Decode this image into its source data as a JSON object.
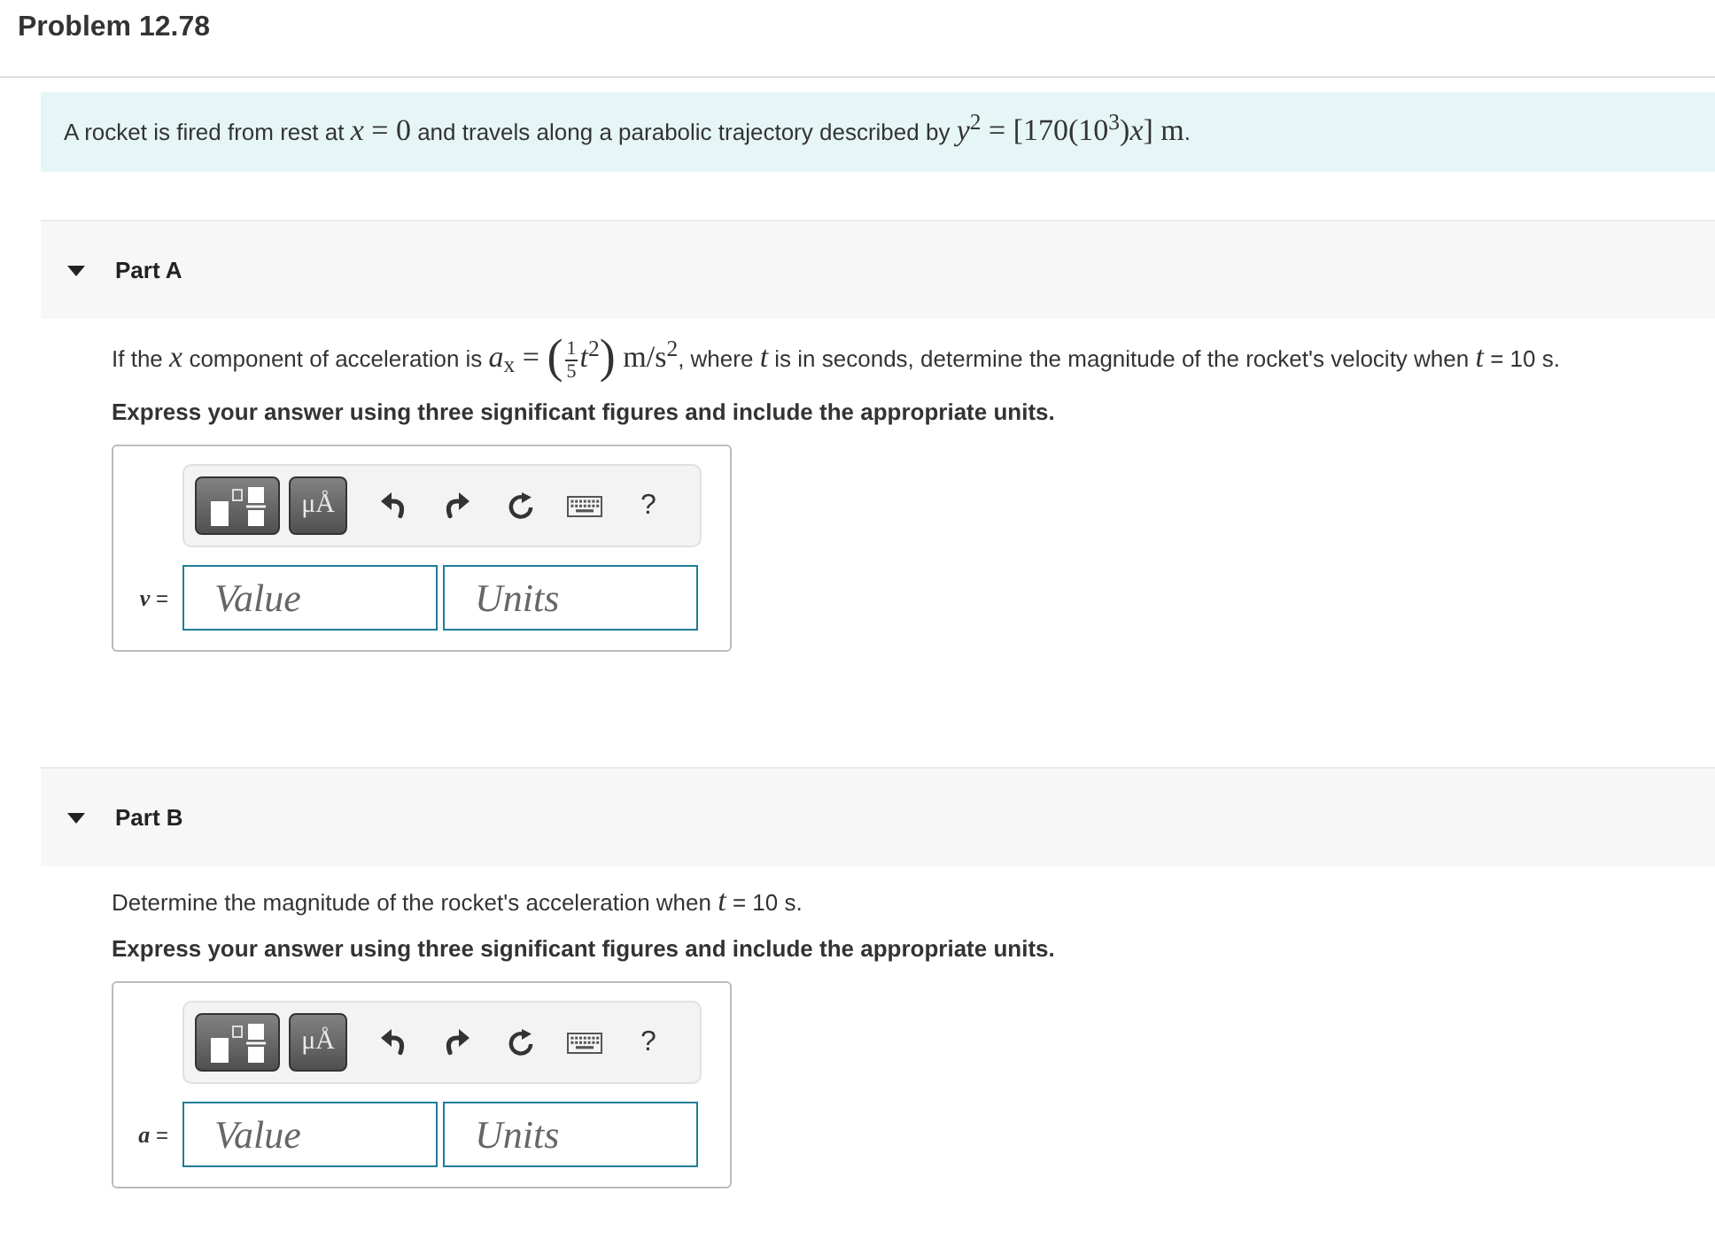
{
  "header": {
    "title": "Problem 12.78"
  },
  "statement": [
    {
      "kind": "text",
      "text": "A rocket is fired from rest at "
    },
    {
      "kind": "math",
      "text": "*x* = 0"
    },
    {
      "kind": "text",
      "text": " and travels along a parabolic trajectory described by "
    },
    {
      "kind": "math",
      "text": "*y*$^{2}$ = [170(10$^{3}$)*x*] m"
    },
    {
      "kind": "text",
      "text": "."
    }
  ],
  "parts": [
    {
      "title": "Part A",
      "expanded": true,
      "question": [
        {
          "kind": "text",
          "text": "If the "
        },
        {
          "kind": "math",
          "text": "*x*"
        },
        {
          "kind": "text",
          "text": " component of acceleration is "
        },
        {
          "kind": "math",
          "text": "*a*$_{x}$ = "
        },
        {
          "kind": "delim",
          "text": "("
        },
        {
          "kind": "frac",
          "num": "1",
          "den": "5"
        },
        {
          "kind": "math",
          "text": "*t*$^{2}$"
        },
        {
          "kind": "delim",
          "text": ")"
        },
        {
          "kind": "math",
          "text": " m/s$^{2}$"
        },
        {
          "kind": "text",
          "text": ", where "
        },
        {
          "kind": "math",
          "text": "*t*"
        },
        {
          "kind": "text",
          "text": " is in seconds, determine the magnitude of the rocket's velocity when "
        },
        {
          "kind": "math",
          "text": "*t*"
        },
        {
          "kind": "text",
          "text": " = 10 s."
        }
      ],
      "instruction": "Express your answer using three significant figures and include the appropriate units.",
      "toolbar": {
        "units_label": "μÅ",
        "help_label": "?"
      },
      "answer": {
        "label": "*v* =",
        "value_placeholder": "Value",
        "units_placeholder": "Units"
      }
    },
    {
      "title": "Part B",
      "expanded": true,
      "question": [
        {
          "kind": "text",
          "text": "Determine the magnitude of the rocket's acceleration when "
        },
        {
          "kind": "math",
          "text": "*t*"
        },
        {
          "kind": "text",
          "text": " = 10 s."
        }
      ],
      "instruction": "Express your answer using three significant figures and include the appropriate units.",
      "toolbar": {
        "units_label": "μÅ",
        "help_label": "?"
      },
      "answer": {
        "label": "*a* =",
        "value_placeholder": "Value",
        "units_placeholder": "Units"
      }
    }
  ]
}
